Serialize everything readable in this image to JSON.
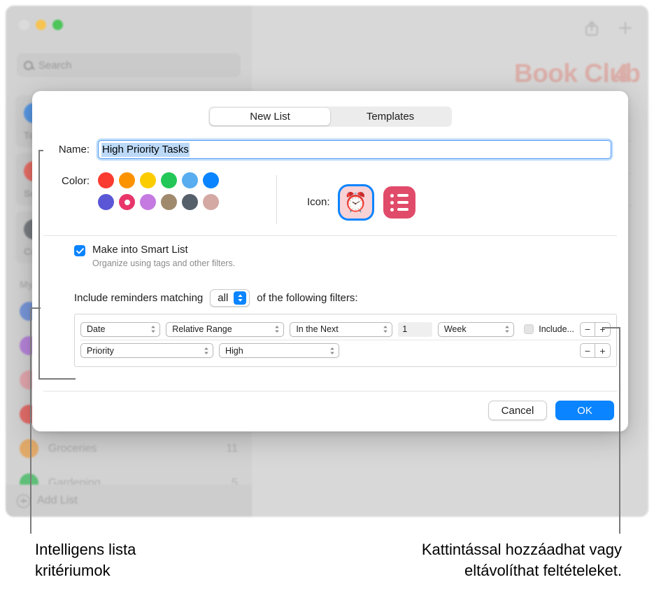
{
  "background": {
    "app_title": "Book Club",
    "count": "4",
    "search_placeholder": "Search",
    "toolbar": {
      "share_icon": "share-icon",
      "add_icon": "plus-icon"
    },
    "smart_lists": [
      {
        "label": "Today",
        "count": "",
        "color": "#4a90e2"
      },
      {
        "label": "Scheduled",
        "count": "",
        "color": "#e8635a"
      },
      {
        "label": "Completed",
        "count": "",
        "color": "#6e7278"
      }
    ],
    "section_label": "My Lists",
    "lists": [
      {
        "name": "Groceries",
        "count": "11",
        "color": "#e0a45e"
      },
      {
        "name": "Gardening",
        "count": "5",
        "color": "#52b96c"
      }
    ],
    "add_list_label": "Add List"
  },
  "dialog": {
    "tabs": [
      {
        "label": "New List",
        "active": true
      },
      {
        "label": "Templates",
        "active": false
      }
    ],
    "name_label": "Name:",
    "name_value": "High Priority Tasks",
    "color_label": "Color:",
    "colors": [
      {
        "name": "red",
        "hex": "#fa3b30"
      },
      {
        "name": "orange",
        "hex": "#fb9300"
      },
      {
        "name": "yellow",
        "hex": "#fbcc00"
      },
      {
        "name": "green",
        "hex": "#23c757"
      },
      {
        "name": "light-blue",
        "hex": "#57adef"
      },
      {
        "name": "blue",
        "hex": "#0a84ff"
      },
      {
        "name": "indigo",
        "hex": "#5a56d6"
      },
      {
        "name": "pink",
        "hex": "#e8366b"
      },
      {
        "name": "violet",
        "hex": "#c47ae0"
      },
      {
        "name": "brown",
        "hex": "#a08a6d"
      },
      {
        "name": "gray",
        "hex": "#56606a"
      },
      {
        "name": "dusty-rose",
        "hex": "#d4a9a3"
      }
    ],
    "selected_color_index": 7,
    "icon_label": "Icon:",
    "icons": [
      {
        "name": "alarm-clock-icon",
        "glyph": "⏰",
        "selected": true
      },
      {
        "name": "list-bullet-icon",
        "glyph": "",
        "selected": false
      }
    ],
    "smart_list": {
      "checkbox_label": "Make into Smart List",
      "checkbox_checked": true,
      "sub_label": "Organize using tags and other filters.",
      "match_prefix": "Include reminders matching",
      "match_value": "all",
      "match_suffix": "of the following filters:"
    },
    "filters": [
      {
        "field": "Date",
        "comparator": "Relative Range",
        "operator": "In the Next",
        "number": "1",
        "unit": "Week",
        "include_label": "Include...",
        "include_checked": false,
        "remove_label": "−",
        "add_label": "+"
      },
      {
        "field": "Priority",
        "value": "High",
        "remove_label": "−",
        "add_label": "+"
      }
    ],
    "buttons": {
      "cancel": "Cancel",
      "ok": "OK"
    },
    "accent_color": "#0a84ff"
  },
  "callouts": {
    "left": "Intelligens lista\nkritériumok",
    "left_line1": "Intelligens lista",
    "left_line2": "kritériumok",
    "right_line1": "Kattintással hozzáadhat vagy",
    "right_line2": "eltávolíthat feltételeket."
  }
}
